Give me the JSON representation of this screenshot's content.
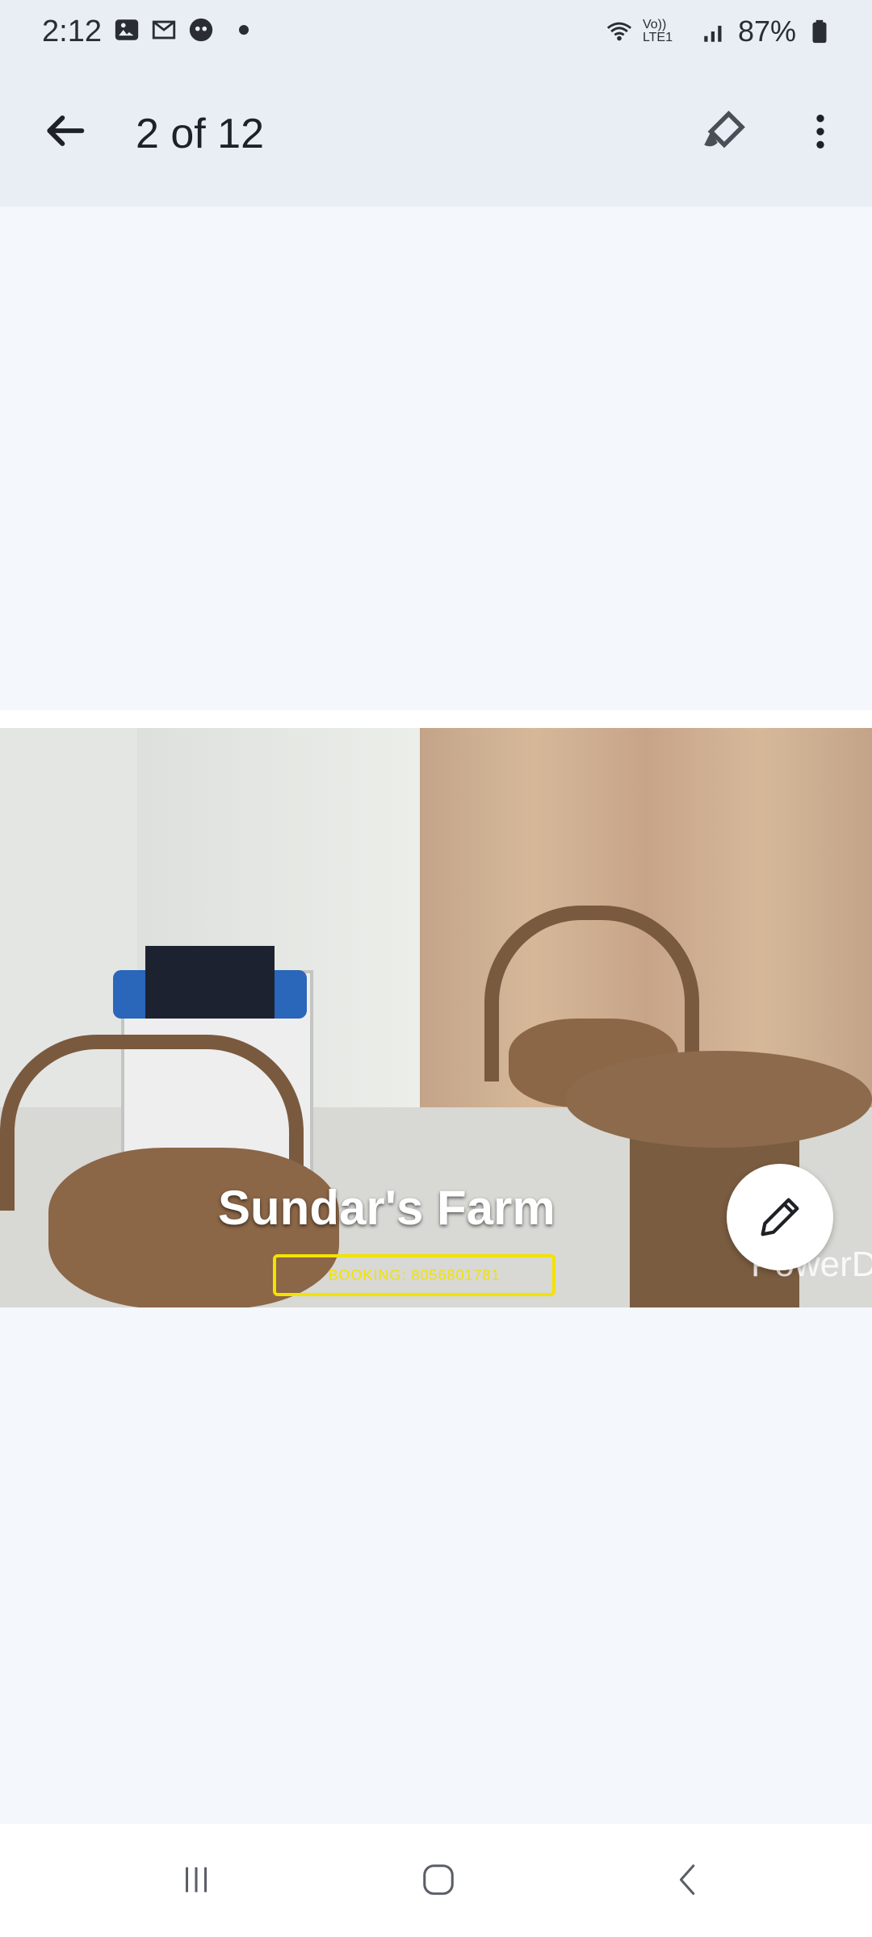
{
  "status_bar": {
    "time": "2:12",
    "battery": "87%",
    "network": "Vo)) LTE1"
  },
  "app_bar": {
    "title": "2 of 12"
  },
  "photo": {
    "brand_text": "Sundar's Farm",
    "booking_text": "BOOKING: 8056801781",
    "watermark": "PowerD"
  },
  "icons": {
    "back": "arrow-left-icon",
    "edit_top": "brush-icon",
    "more": "more-vert-icon",
    "fab": "pencil-icon"
  }
}
